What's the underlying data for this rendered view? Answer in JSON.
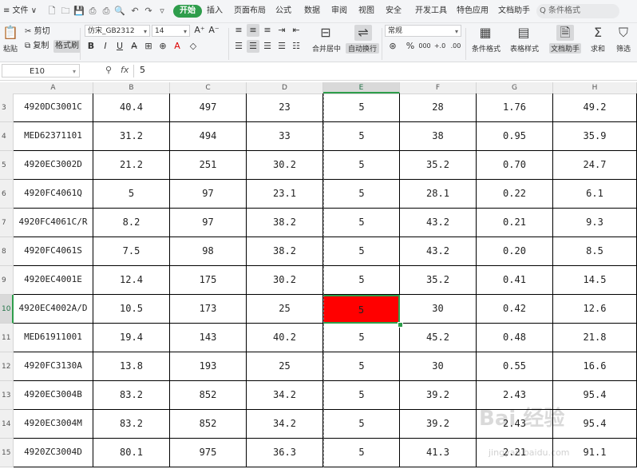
{
  "menubar": {
    "file_label": "≡ 文件 ∨",
    "quick_icons": [
      "new-file-icon",
      "open-icon",
      "save-icon",
      "format-painter-quick-icon",
      "print-icon",
      "preview-icon",
      "undo-icon",
      "redo-icon",
      "customize-icon"
    ],
    "tabs": [
      "开始",
      "插入",
      "页面布局",
      "公式",
      "数据",
      "审阅",
      "视图",
      "安全",
      "开发工具",
      "特色应用",
      "文档助手"
    ],
    "active_tab": "开始",
    "search_placeholder": "Q 条件格式"
  },
  "ribbon": {
    "paste": "粘贴",
    "cut": "剪切",
    "copy": "复制",
    "format_painter": "格式刷",
    "font_name": "仿宋_GB2312",
    "font_size": "14",
    "merge_center": "合并居中",
    "wrap_text": "自动换行",
    "number_format": "常规",
    "conditional_format": "条件格式",
    "table_style": "表格样式",
    "doc_assistant": "文档助手",
    "sum": "求和",
    "filter": "筛选",
    "bold": "B",
    "italic": "I",
    "underline": "U",
    "percent": "%",
    "thousands": "000",
    "inc_decimal": "+.0",
    "dec_decimal": ".00"
  },
  "formula_bar": {
    "cell_ref": "E10",
    "fx": "fx",
    "value": "5"
  },
  "columns": [
    "A",
    "B",
    "C",
    "D",
    "E",
    "F",
    "G",
    "H"
  ],
  "selected_column": "E",
  "rows": [
    {
      "num": "3",
      "cells": [
        "4920DC3001C",
        "40.4",
        "497",
        "23",
        "5",
        "28",
        "1.76",
        "49.2"
      ]
    },
    {
      "num": "4",
      "cells": [
        "MED62371101",
        "31.2",
        "494",
        "33",
        "5",
        "38",
        "0.95",
        "35.9"
      ]
    },
    {
      "num": "5",
      "cells": [
        "4920EC3002D",
        "21.2",
        "251",
        "30.2",
        "5",
        "35.2",
        "0.70",
        "24.7"
      ]
    },
    {
      "num": "6",
      "cells": [
        "4920FC4061Q",
        "5",
        "97",
        "23.1",
        "5",
        "28.1",
        "0.22",
        "6.1"
      ]
    },
    {
      "num": "7",
      "cells": [
        "4920FC4061C/R",
        "8.2",
        "97",
        "38.2",
        "5",
        "43.2",
        "0.21",
        "9.3"
      ]
    },
    {
      "num": "8",
      "cells": [
        "4920FC4061S",
        "7.5",
        "98",
        "38.2",
        "5",
        "43.2",
        "0.20",
        "8.5"
      ]
    },
    {
      "num": "9",
      "cells": [
        "4920EC4001E",
        "12.4",
        "175",
        "30.2",
        "5",
        "35.2",
        "0.41",
        "14.5"
      ]
    },
    {
      "num": "10",
      "cells": [
        "4920EC4002A/D",
        "10.5",
        "173",
        "25",
        "5",
        "30",
        "0.42",
        "12.6"
      ]
    },
    {
      "num": "11",
      "cells": [
        "MED61911001",
        "19.4",
        "143",
        "40.2",
        "5",
        "45.2",
        "0.48",
        "21.8"
      ]
    },
    {
      "num": "12",
      "cells": [
        "4920FC3130A",
        "13.8",
        "193",
        "25",
        "5",
        "30",
        "0.55",
        "16.6"
      ]
    },
    {
      "num": "13",
      "cells": [
        "4920EC3004B",
        "83.2",
        "852",
        "34.2",
        "5",
        "39.2",
        "2.43",
        "95.4"
      ]
    },
    {
      "num": "14",
      "cells": [
        "4920EC3004M",
        "83.2",
        "852",
        "34.2",
        "5",
        "39.2",
        "2.43",
        "95.4"
      ]
    },
    {
      "num": "15",
      "cells": [
        "4920ZC3004D",
        "80.1",
        "975",
        "36.3",
        "5",
        "41.3",
        "2.21",
        "91.1"
      ]
    }
  ],
  "selected_row": "10",
  "active_cell_color": "#ff0000",
  "accent_color": "#2e9d4b",
  "watermark": "Bai 经验",
  "watermark_sub": "jingyan.baidu.com"
}
